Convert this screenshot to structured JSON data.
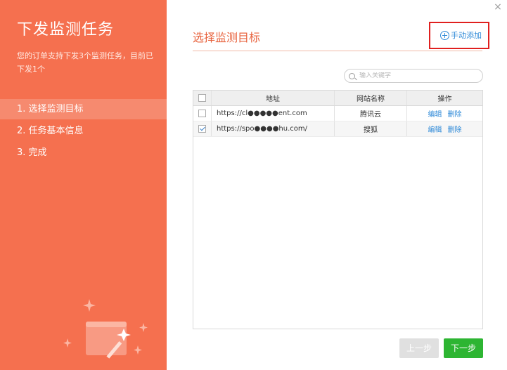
{
  "sidebar": {
    "title": "下发监测任务",
    "desc": "您的订单支持下发3个监测任务，目前已下发1个",
    "steps": [
      {
        "label": "1. 选择监测目标",
        "active": true
      },
      {
        "label": "2. 任务基本信息",
        "active": false
      },
      {
        "label": "3. 完成",
        "active": false
      }
    ]
  },
  "window": {
    "close_symbol": "×"
  },
  "main": {
    "title": "选择监测目标",
    "manual_add_label": "手动添加",
    "search": {
      "placeholder": "输入关键字",
      "value": ""
    },
    "table": {
      "headers": {
        "address": "地址",
        "site_name": "网站名称",
        "actions": "操作"
      },
      "rows": [
        {
          "address": "https://cl●●●●●ent.com",
          "site_name": "腾讯云",
          "checked": false,
          "edit": "编辑",
          "delete": "删除"
        },
        {
          "address": "https://spo●●●●hu.com/",
          "site_name": "搜狐",
          "checked": true,
          "edit": "编辑",
          "delete": "删除"
        }
      ]
    },
    "buttons": {
      "prev": "上一步",
      "next": "下一步"
    }
  },
  "colors": {
    "sidebar_bg": "#f5704f",
    "accent": "#e8643f",
    "link": "#2f8ad8",
    "next_button": "#2db532",
    "highlight_box": "#e0201f"
  }
}
